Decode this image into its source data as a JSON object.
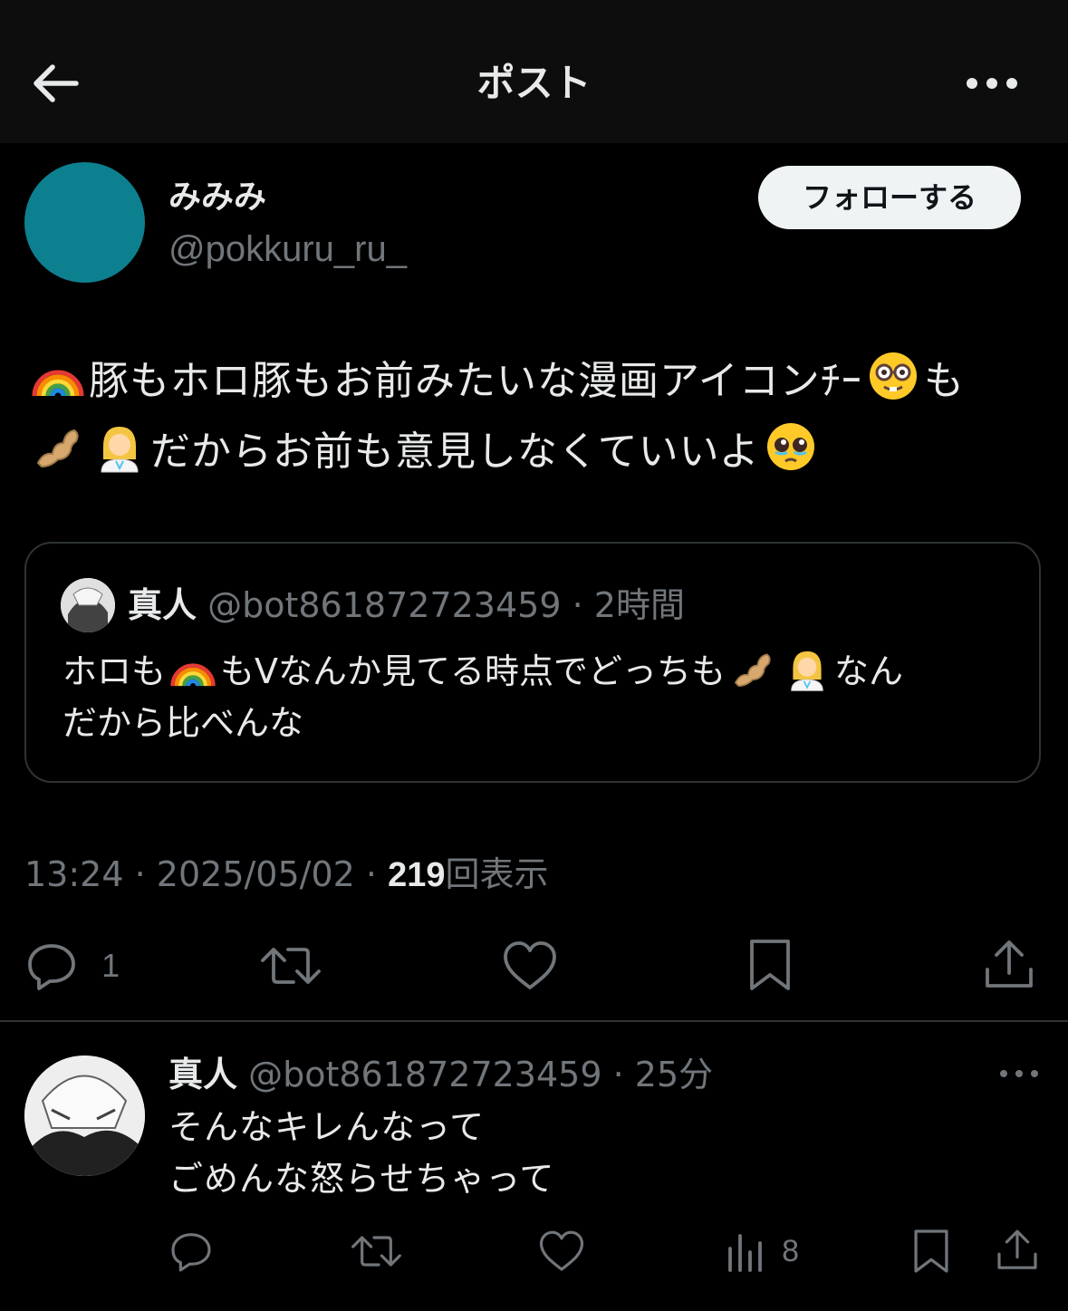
{
  "header": {
    "title": "ポスト"
  },
  "post": {
    "display_name": "みみみ",
    "handle": "@pokkuru_ru_",
    "avatar_color": "#0d8090",
    "follow_label": "フォローする",
    "text_part1": "豚もホロ豚もお前みたいな漫画アイコンﾁｰ",
    "text_part2": "も",
    "text_part3": "だからお前も意見しなくていいよ",
    "time": "13:24",
    "date": "2025/05/02",
    "views": "219",
    "views_label": "回表示",
    "sep": "·",
    "reply_count": "1"
  },
  "quote": {
    "name": "真人",
    "handle": "@bot861872723459",
    "sep": "·",
    "time": "2時間",
    "text_part1": "ホロも",
    "text_part2": "もVなんか見てる時点でどっちも",
    "text_part3": "なん",
    "text_part4": "だから比べんな"
  },
  "reply": {
    "name": "真人",
    "handle": "@bot861872723459",
    "sep": "·",
    "time": "25分",
    "line1": "そんなキレんなって",
    "line2": "ごめんな怒らせちゃって",
    "views_count": "8"
  },
  "icons": [
    "back-arrow-icon",
    "more-icon",
    "rainbow-icon",
    "nerd-face-icon",
    "ginger-icon",
    "woman-health-worker-icon",
    "pleading-face-icon",
    "reply-icon",
    "retweet-icon",
    "like-icon",
    "bookmark-icon",
    "share-icon",
    "views-icon"
  ],
  "colors": {
    "background": "#000000",
    "text": "#e7e9ea",
    "muted": "#71767b",
    "border": "#2f3336",
    "follow_bg": "#eff3f4"
  }
}
